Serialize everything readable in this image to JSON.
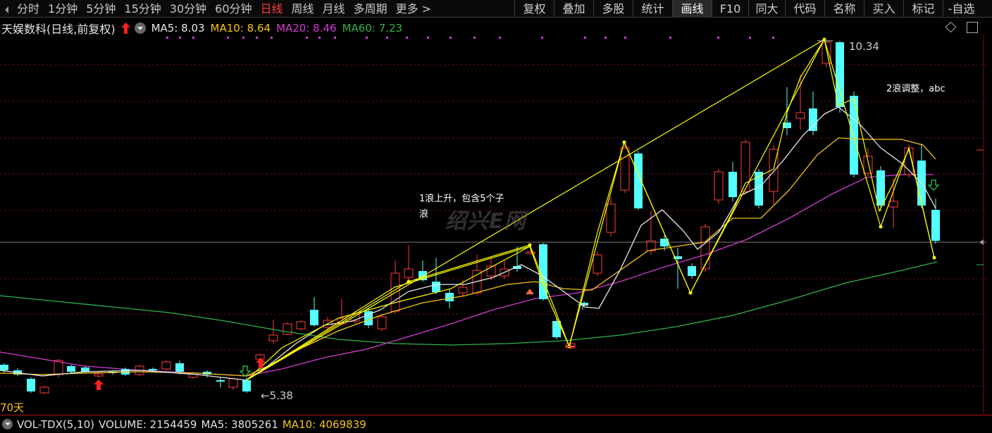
{
  "toolbar": {
    "period_tabs": [
      "分时",
      "1分钟",
      "5分钟",
      "15分钟",
      "30分钟",
      "60分钟",
      "日线",
      "周线",
      "月线",
      "多周期",
      "更多 >"
    ],
    "active_period": "日线",
    "function_tabs": [
      "复权",
      "叠加",
      "多股",
      "统计",
      "画线",
      "F10",
      "同大",
      "代码",
      "名称",
      "买入",
      "标记",
      "-自选"
    ],
    "active_function": "画线"
  },
  "chart_header": {
    "title": "天娱数科(日线,前复权)",
    "ma5": "MA5: 8.03",
    "ma10": "MA10: 8.64",
    "ma20": "MA20: 8.46",
    "ma60": "MA60: 7.23"
  },
  "annotations": {
    "wave1_line1": "1浪上升，包含5个子",
    "wave1_line2": "浪",
    "wave2": "2浪调整，abc"
  },
  "price_labels": {
    "high": "10.34",
    "low": "5.38"
  },
  "watermark": "绍兴E网",
  "days_label": "70天",
  "volume_bar": {
    "indicator": "VOL-TDX(5,10)",
    "volume": "VOLUME: 2154459",
    "ma5": "MA5: 3805261",
    "ma10": "MA10: 4069839"
  },
  "colors": {
    "up_candle": "#ff3b3b",
    "down_candle": "#54ffff",
    "ma5": "#e8e8e8",
    "ma10": "#f5c518",
    "ma20": "#d33cd3",
    "ma60": "#2fb24a",
    "wave_lines": "#ffff00"
  },
  "icons": [
    "red-up-arrow-icon",
    "green-down-arrow-icon",
    "diamond-icon",
    "square-icon",
    "indicator-menu-icon"
  ]
}
